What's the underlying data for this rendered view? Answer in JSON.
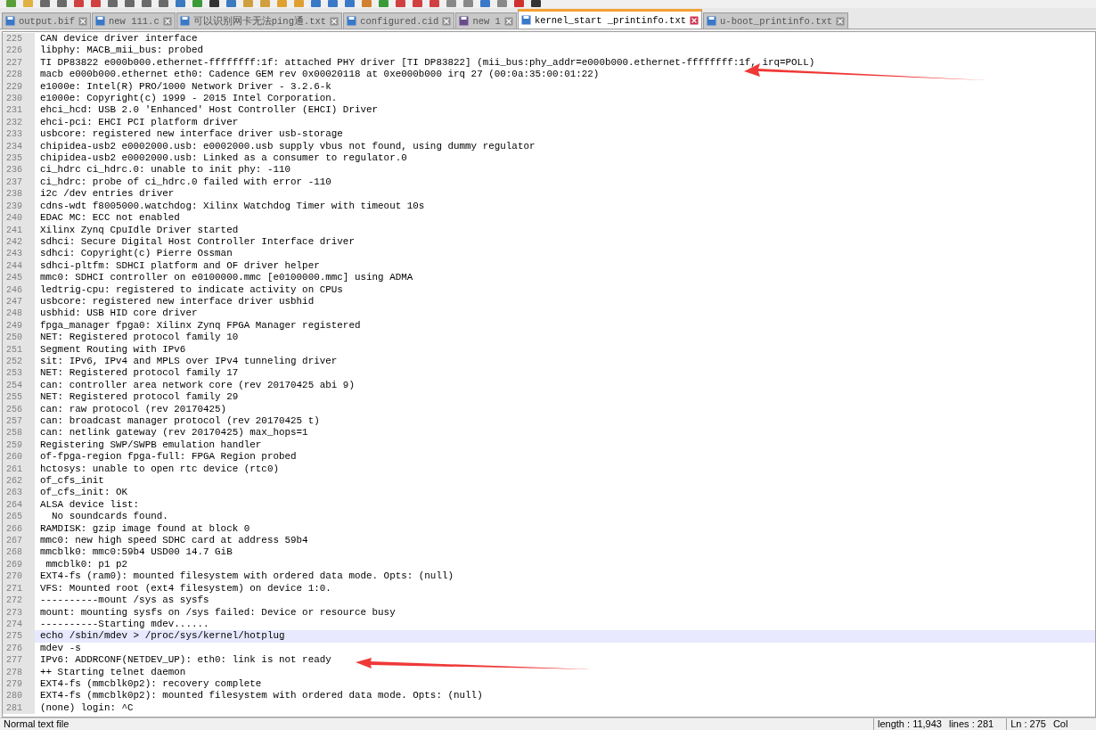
{
  "tabs": [
    {
      "label": "output.bif",
      "selected": false,
      "color": "#3a78c8"
    },
    {
      "label": "new 111.c",
      "selected": false,
      "color": "#3a78c8"
    },
    {
      "label": "可以识别网卡无法ping通.txt",
      "selected": false,
      "color": "#3a78c8"
    },
    {
      "label": "configured.cid",
      "selected": false,
      "color": "#3a78c8"
    },
    {
      "label": "new 1",
      "selected": false,
      "color": "#6a4c8c"
    },
    {
      "label": "kernel_start _printinfo.txt",
      "selected": true,
      "color": "#3a78c8"
    },
    {
      "label": "u-boot_printinfo.txt",
      "selected": false,
      "color": "#3a78c8"
    }
  ],
  "lines": [
    {
      "number": "225",
      "text": "CAN device driver interface",
      "current": false
    },
    {
      "number": "226",
      "text": "libphy: MACB_mii_bus: probed",
      "current": false
    },
    {
      "number": "227",
      "text": "TI DP83822 e000b000.ethernet-ffffffff:1f: attached PHY driver [TI DP83822] (mii_bus:phy_addr=e000b000.ethernet-ffffffff:1f, irq=POLL)",
      "current": false
    },
    {
      "number": "228",
      "text": "macb e000b000.ethernet eth0: Cadence GEM rev 0x00020118 at 0xe000b000 irq 27 (00:0a:35:00:01:22)",
      "current": false
    },
    {
      "number": "229",
      "text": "e1000e: Intel(R) PRO/1000 Network Driver - 3.2.6-k",
      "current": false
    },
    {
      "number": "230",
      "text": "e1000e: Copyright(c) 1999 - 2015 Intel Corporation.",
      "current": false
    },
    {
      "number": "231",
      "text": "ehci_hcd: USB 2.0 'Enhanced' Host Controller (EHCI) Driver",
      "current": false
    },
    {
      "number": "232",
      "text": "ehci-pci: EHCI PCI platform driver",
      "current": false
    },
    {
      "number": "233",
      "text": "usbcore: registered new interface driver usb-storage",
      "current": false
    },
    {
      "number": "234",
      "text": "chipidea-usb2 e0002000.usb: e0002000.usb supply vbus not found, using dummy regulator",
      "current": false
    },
    {
      "number": "235",
      "text": "chipidea-usb2 e0002000.usb: Linked as a consumer to regulator.0",
      "current": false
    },
    {
      "number": "236",
      "text": "ci_hdrc ci_hdrc.0: unable to init phy: -110",
      "current": false
    },
    {
      "number": "237",
      "text": "ci_hdrc: probe of ci_hdrc.0 failed with error -110",
      "current": false
    },
    {
      "number": "238",
      "text": "i2c /dev entries driver",
      "current": false
    },
    {
      "number": "239",
      "text": "cdns-wdt f8005000.watchdog: Xilinx Watchdog Timer with timeout 10s",
      "current": false
    },
    {
      "number": "240",
      "text": "EDAC MC: ECC not enabled",
      "current": false
    },
    {
      "number": "241",
      "text": "Xilinx Zynq CpuIdle Driver started",
      "current": false
    },
    {
      "number": "242",
      "text": "sdhci: Secure Digital Host Controller Interface driver",
      "current": false
    },
    {
      "number": "243",
      "text": "sdhci: Copyright(c) Pierre Ossman",
      "current": false
    },
    {
      "number": "244",
      "text": "sdhci-pltfm: SDHCI platform and OF driver helper",
      "current": false
    },
    {
      "number": "245",
      "text": "mmc0: SDHCI controller on e0100000.mmc [e0100000.mmc] using ADMA",
      "current": false
    },
    {
      "number": "246",
      "text": "ledtrig-cpu: registered to indicate activity on CPUs",
      "current": false
    },
    {
      "number": "247",
      "text": "usbcore: registered new interface driver usbhid",
      "current": false
    },
    {
      "number": "248",
      "text": "usbhid: USB HID core driver",
      "current": false
    },
    {
      "number": "249",
      "text": "fpga_manager fpga0: Xilinx Zynq FPGA Manager registered",
      "current": false
    },
    {
      "number": "250",
      "text": "NET: Registered protocol family 10",
      "current": false
    },
    {
      "number": "251",
      "text": "Segment Routing with IPv6",
      "current": false
    },
    {
      "number": "252",
      "text": "sit: IPv6, IPv4 and MPLS over IPv4 tunneling driver",
      "current": false
    },
    {
      "number": "253",
      "text": "NET: Registered protocol family 17",
      "current": false
    },
    {
      "number": "254",
      "text": "can: controller area network core (rev 20170425 abi 9)",
      "current": false
    },
    {
      "number": "255",
      "text": "NET: Registered protocol family 29",
      "current": false
    },
    {
      "number": "256",
      "text": "can: raw protocol (rev 20170425)",
      "current": false
    },
    {
      "number": "257",
      "text": "can: broadcast manager protocol (rev 20170425 t)",
      "current": false
    },
    {
      "number": "258",
      "text": "can: netlink gateway (rev 20170425) max_hops=1",
      "current": false
    },
    {
      "number": "259",
      "text": "Registering SWP/SWPB emulation handler",
      "current": false
    },
    {
      "number": "260",
      "text": "of-fpga-region fpga-full: FPGA Region probed",
      "current": false
    },
    {
      "number": "261",
      "text": "hctosys: unable to open rtc device (rtc0)",
      "current": false
    },
    {
      "number": "262",
      "text": "of_cfs_init",
      "current": false
    },
    {
      "number": "263",
      "text": "of_cfs_init: OK",
      "current": false
    },
    {
      "number": "264",
      "text": "ALSA device list:",
      "current": false
    },
    {
      "number": "265",
      "text": "  No soundcards found.",
      "current": false
    },
    {
      "number": "266",
      "text": "RAMDISK: gzip image found at block 0",
      "current": false
    },
    {
      "number": "267",
      "text": "mmc0: new high speed SDHC card at address 59b4",
      "current": false
    },
    {
      "number": "268",
      "text": "mmcblk0: mmc0:59b4 USD00 14.7 GiB",
      "current": false
    },
    {
      "number": "269",
      "text": " mmcblk0: p1 p2",
      "current": false
    },
    {
      "number": "270",
      "text": "EXT4-fs (ram0): mounted filesystem with ordered data mode. Opts: (null)",
      "current": false
    },
    {
      "number": "271",
      "text": "VFS: Mounted root (ext4 filesystem) on device 1:0.",
      "current": false
    },
    {
      "number": "272",
      "text": "----------mount /sys as sysfs",
      "current": false
    },
    {
      "number": "273",
      "text": "mount: mounting sysfs on /sys failed: Device or resource busy",
      "current": false
    },
    {
      "number": "274",
      "text": "----------Starting mdev......",
      "current": false
    },
    {
      "number": "275",
      "text": "echo /sbin/mdev > /proc/sys/kernel/hotplug",
      "current": true
    },
    {
      "number": "276",
      "text": "mdev -s",
      "current": false
    },
    {
      "number": "277",
      "text": "IPv6: ADDRCONF(NETDEV_UP): eth0: link is not ready",
      "current": false
    },
    {
      "number": "278",
      "text": "++ Starting telnet daemon",
      "current": false
    },
    {
      "number": "279",
      "text": "EXT4-fs (mmcblk0p2): recovery complete",
      "current": false
    },
    {
      "number": "280",
      "text": "EXT4-fs (mmcblk0p2): mounted filesystem with ordered data mode. Opts: (null)",
      "current": false
    },
    {
      "number": "281",
      "text": "(none) login: ^C",
      "current": false
    }
  ],
  "status_bar": {
    "file_type": "Normal text file",
    "length": "length : 11,943",
    "lines": "lines : 281",
    "position": "Ln : 275",
    "column": "Col"
  }
}
